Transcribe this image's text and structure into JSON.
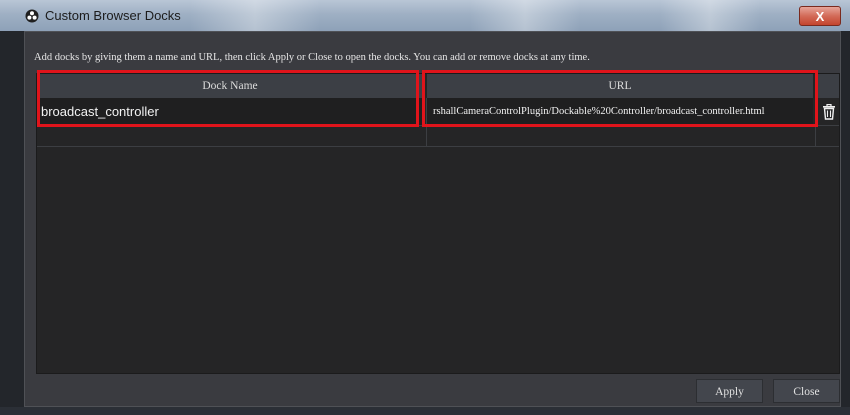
{
  "window": {
    "title": "Custom Browser Docks",
    "close_label": "X"
  },
  "hint": "Add docks by giving them a name and URL, then click Apply or Close to open the docks. You can add or remove docks at any time.",
  "table": {
    "headers": {
      "name": "Dock Name",
      "url": "URL"
    },
    "rows": [
      {
        "name": "broadcast_controller",
        "url": "rshallCameraControlPlugin/Dockable%20Controller/broadcast_controller.html"
      }
    ]
  },
  "buttons": {
    "apply": "Apply",
    "close": "Close"
  },
  "icons": {
    "app": "obs-logo-icon",
    "delete": "trash-icon",
    "close": "close-icon"
  },
  "colors": {
    "highlight": "#e0141b",
    "background": "#252526",
    "header": "#3c3f45"
  }
}
